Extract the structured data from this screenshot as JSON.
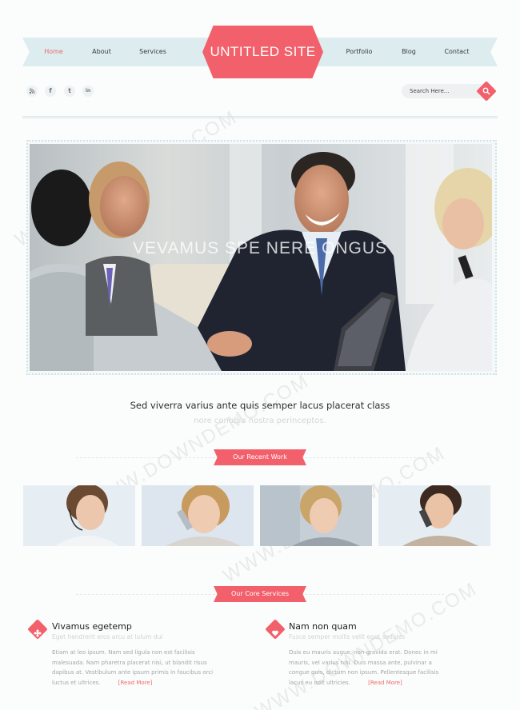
{
  "nav": {
    "items": [
      {
        "label": "Home",
        "active": true
      },
      {
        "label": "About",
        "active": false
      },
      {
        "label": "Services",
        "active": false
      },
      {
        "label": "Portfolio",
        "active": false
      },
      {
        "label": "Blog",
        "active": false
      },
      {
        "label": "Contact",
        "active": false
      }
    ]
  },
  "logo": {
    "text": "UNTITLED SITE"
  },
  "social": [
    {
      "icon": "rss-icon",
      "glyph": "ⓡ"
    },
    {
      "icon": "facebook-icon",
      "glyph": "f"
    },
    {
      "icon": "twitter-icon",
      "glyph": "t"
    },
    {
      "icon": "linkedin-icon",
      "glyph": "in"
    }
  ],
  "search": {
    "placeholder": "Search Here..."
  },
  "hero": {
    "caption": "VEVAMUS SPE                    NERE ONGUS"
  },
  "intro": {
    "title": "Sed viverra varius ante quis semper lacus placerat class",
    "subtitle": "nore conubia nostra perinceptos."
  },
  "work": {
    "title": "Our Recent Work"
  },
  "services": {
    "title": "Our Core Services",
    "items": [
      {
        "title": "Vivamus egetemp",
        "subtitle": "Eget hendrerit eros arcu at lulum dui",
        "body": "Etiam at leo ipsum. Nam sed ligula non est facilisis malesuada. Nam pharetra placerat nisi, ut blandit risus dapibus at. Vestibulum ante ipsum primis in faucibus orci luctus et ultrices.",
        "read_more": "[Read More]"
      },
      {
        "title": "Nam non quam",
        "subtitle": "Fusce semper mollis velit eget sodales",
        "body": "Duis eu mauris augue, non gravida erat. Donec in mi mauris, vel varius nisi. Duis massa ante, pulvinar a congue quis, dictum non ipsum. Pellentesque facilisis lacus eu odit ultricies.",
        "read_more": "[Read More]"
      }
    ]
  },
  "watermark": "WWW.DOWNDEMO.COM",
  "colors": {
    "accent": "#f2606b",
    "ribbon": "#dcecef"
  }
}
